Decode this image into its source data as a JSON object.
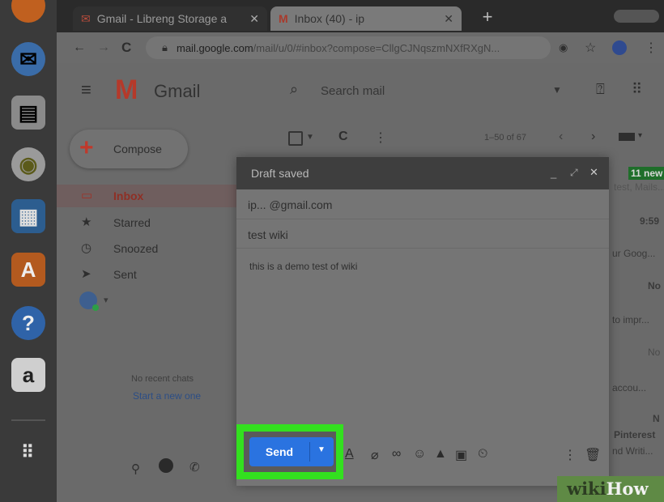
{
  "browser": {
    "tabs": [
      {
        "label": "Gmail - Libreng Storage a"
      },
      {
        "label": "Inbox (40) - ip"
      }
    ],
    "url": {
      "host": "mail.google.com",
      "path": "/mail/u/0/#inbox?compose=CllgCJNqszmNXfRXgN..."
    }
  },
  "gmail": {
    "logo_text": "Gmail",
    "search_placeholder": "Search mail",
    "compose_label": "Compose",
    "nav": [
      {
        "label": "Inbox"
      },
      {
        "label": "Starred"
      },
      {
        "label": "Snoozed"
      },
      {
        "label": "Sent"
      }
    ],
    "pagination": "1–50 of 67",
    "no_chats": "No recent chats",
    "start_chat": "Start a new one",
    "right_snippets": [
      "11 new",
      "test, Mails...",
      "9:59",
      "ur Goog...",
      "No",
      "to impr...",
      "No",
      "accou...",
      "N",
      "Pinterest",
      "nd Writi..."
    ]
  },
  "compose": {
    "title": "Draft saved",
    "to": "ip... @gmail.com",
    "subject": "test wiki",
    "body": "this is a demo test of wiki",
    "send_label": "Send"
  },
  "watermark": {
    "wiki": "wiki",
    "how": "How"
  },
  "colors": {
    "highlight": "#33e01f",
    "send": "#2a73e0",
    "gmail_red": "#c0392b"
  }
}
